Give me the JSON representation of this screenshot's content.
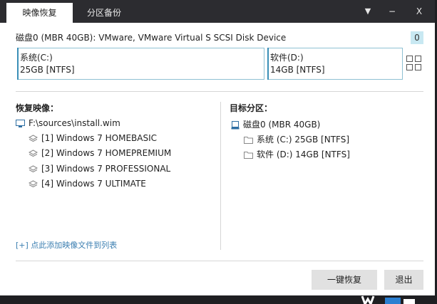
{
  "tabs": [
    {
      "label": "映像恢复",
      "active": true
    },
    {
      "label": "分区备份",
      "active": false
    }
  ],
  "titlebar": {
    "menu_glyph": "▼",
    "minimize_glyph": "−",
    "close_glyph": "X"
  },
  "disk": {
    "title": "磁盘0 (MBR 40GB): VMware, VMware Virtual S SCSI Disk Device",
    "badge": "0",
    "partitions": [
      {
        "name": "系统(C:)",
        "size": "25GB [NTFS]"
      },
      {
        "name": "软件(D:)",
        "size": "14GB [NTFS]"
      }
    ]
  },
  "restore_image": {
    "title": "恢复映像：",
    "file": "F:\\sources\\install.wim",
    "editions": [
      "[1] Windows 7 HOMEBASIC",
      "[2] Windows 7 HOMEPREMIUM",
      "[3] Windows 7 PROFESSIONAL",
      "[4] Windows 7 ULTIMATE"
    ],
    "add_link": "[+] 点此添加映像文件到列表"
  },
  "target_partition": {
    "title": "目标分区：",
    "disk": "磁盘0 (MBR 40GB)",
    "partitions": [
      "系统 (C:) 25GB [NTFS]",
      "软件 (D:) 14GB [NTFS]"
    ]
  },
  "buttons": {
    "restore": "一键恢复",
    "exit": "退出"
  },
  "colors": {
    "titlebar": "#2c2c30",
    "accent": "#3a8fb7",
    "badge": "#c8e8f2",
    "link": "#3c7fb1",
    "button": "#e1e1e1"
  }
}
